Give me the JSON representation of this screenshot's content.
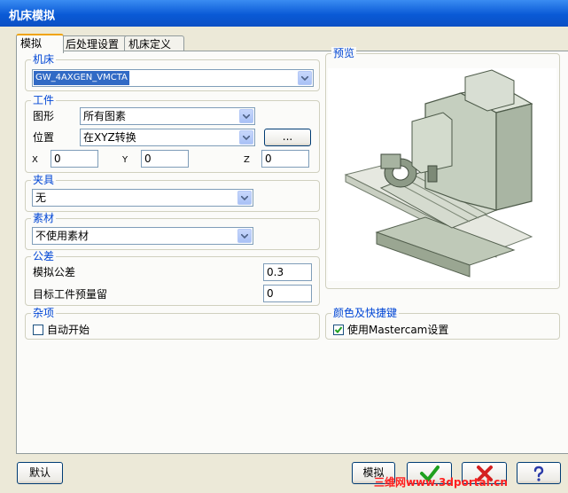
{
  "window": {
    "title": "机床模拟"
  },
  "tabs": [
    {
      "label": "模拟",
      "active": true
    },
    {
      "label": "后处理设置",
      "active": false
    },
    {
      "label": "机床定义",
      "active": false
    }
  ],
  "machine": {
    "legend": "机床",
    "selected": "GW_4AXGEN_VMCTA"
  },
  "workpiece": {
    "legend": "工件",
    "shape_label": "图形",
    "shape_value": "所有图素",
    "position_label": "位置",
    "position_value": "在XYZ转换",
    "browse_label": "...",
    "x_label": "X",
    "x_value": "0",
    "y_label": "Y",
    "y_value": "0",
    "z_label": "Z",
    "z_value": "0"
  },
  "fixture": {
    "legend": "夹具",
    "value": "无"
  },
  "stock": {
    "legend": "素材",
    "value": "不使用素材"
  },
  "tolerance": {
    "legend": "公差",
    "sim_label": "模拟公差",
    "sim_value": "0.3",
    "stock_label": "目标工件预量留",
    "stock_value": "0"
  },
  "misc": {
    "legend": "杂项",
    "autostart_label": "自动开始",
    "autostart_checked": false
  },
  "preview": {
    "legend": "预览"
  },
  "colors": {
    "legend": "颜色及快捷键",
    "use_mastercam_label": "使用Mastercam设置",
    "use_mastercam_checked": true
  },
  "footer": {
    "default_label": "默认",
    "simulate_label": "模拟",
    "ok_icon": "green-check-icon",
    "cancel_icon": "red-x-icon",
    "help_icon": "question-mark-icon"
  },
  "watermark": "三维网www.3dportal.cn",
  "theme": {
    "title_blue": "#0a5ad6",
    "legend_blue": "#0046d5",
    "ok_green": "#1ea01e",
    "cancel_red": "#d42020",
    "select_blue": "#316ac5"
  }
}
